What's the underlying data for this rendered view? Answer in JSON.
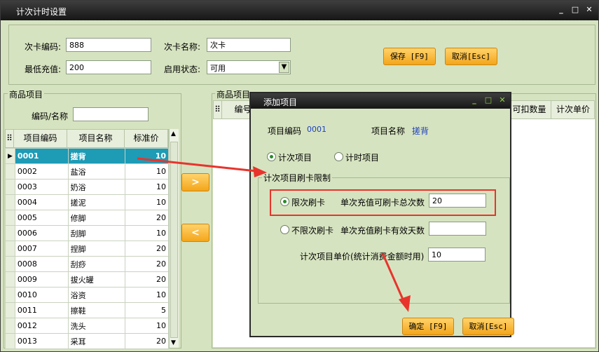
{
  "window": {
    "title": "计次计时设置",
    "min": "_",
    "max": "□",
    "close": "✕"
  },
  "top": {
    "card_code_label": "次卡编码:",
    "card_code_value": "888",
    "card_name_label": "次卡名称:",
    "card_name_value": "次卡",
    "min_recharge_label": "最低充值:",
    "min_recharge_value": "200",
    "status_label": "启用状态:",
    "status_value": "可用",
    "save_label": "保存 [F9]",
    "cancel_label": "取消[Esc]"
  },
  "left": {
    "section_label": "商品项目",
    "search_label": "编码/名称",
    "search_value": "",
    "headers": [
      "项目编码",
      "项目名称",
      "标准价"
    ],
    "rows": [
      [
        "0001",
        "搓背",
        "10"
      ],
      [
        "0002",
        "盐浴",
        "10"
      ],
      [
        "0003",
        "奶浴",
        "10"
      ],
      [
        "0004",
        "搓泥",
        "10"
      ],
      [
        "0005",
        "修脚",
        "20"
      ],
      [
        "0006",
        "刮脚",
        "10"
      ],
      [
        "0007",
        "捏脚",
        "20"
      ],
      [
        "0008",
        "刮痧",
        "20"
      ],
      [
        "0009",
        "拔火罐",
        "20"
      ],
      [
        "0010",
        "浴资",
        "10"
      ],
      [
        "0011",
        "擦鞋",
        "5"
      ],
      [
        "0012",
        "洗头",
        "10"
      ],
      [
        "0013",
        "采耳",
        "20"
      ]
    ]
  },
  "middle": {
    "add_arrow": ">",
    "remove_arrow": "<"
  },
  "right": {
    "section_label": "商品项目",
    "headers": [
      "编号",
      "可扣数量",
      "计次单价"
    ]
  },
  "dialog": {
    "title": "添加项目",
    "code_label": "项目编码",
    "code_value": "0001",
    "name_label": "项目名称",
    "name_value": "搓背",
    "radio_count": "计次项目",
    "radio_time": "计时项目",
    "group_label": "计次项目刷卡限制",
    "limited_label": "限次刷卡",
    "limited_count_label": "单次充值可刷卡总次数",
    "limited_count_value": "20",
    "unlimited_label": "不限次刷卡",
    "unlimited_days_label": "单次充值刷卡有效天数",
    "unlimited_days_value": "",
    "unit_price_label": "计次项目单价(统计消费金额时用)",
    "unit_price_value": "10",
    "ok_label": "确定 [F9]",
    "cancel_label": "取消[Esc]"
  },
  "colors": {
    "accent": "#f4a51a",
    "selected_row": "#1e9bb5",
    "annotation": "#e8342c"
  }
}
